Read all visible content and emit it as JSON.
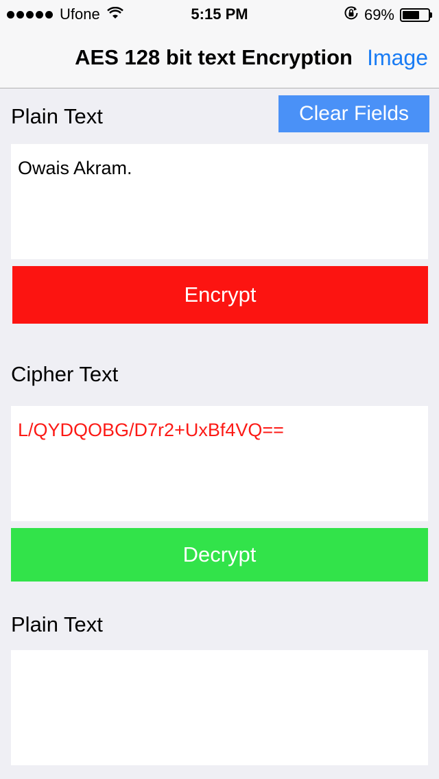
{
  "status_bar": {
    "carrier": "Ufone",
    "time": "5:15 PM",
    "battery_percent": "69%",
    "battery_level": 0.69
  },
  "nav": {
    "title": "AES 128 bit text Encryption",
    "right_button": "Image"
  },
  "form": {
    "plain_label": "Plain Text",
    "clear_button": "Clear Fields",
    "plain_value": "Owais Akram.",
    "encrypt_button": "Encrypt",
    "cipher_label": "Cipher Text",
    "cipher_value": "L/QYDQOBG/D7r2+UxBf4VQ==",
    "decrypt_button": "Decrypt",
    "output_label": "Plain Text",
    "output_value": ""
  },
  "colors": {
    "accent": "#1a7cf4",
    "clear_button": "#4a91f7",
    "encrypt": "#fc1411",
    "decrypt": "#32e34a",
    "cipher_text": "#fc1a16"
  }
}
